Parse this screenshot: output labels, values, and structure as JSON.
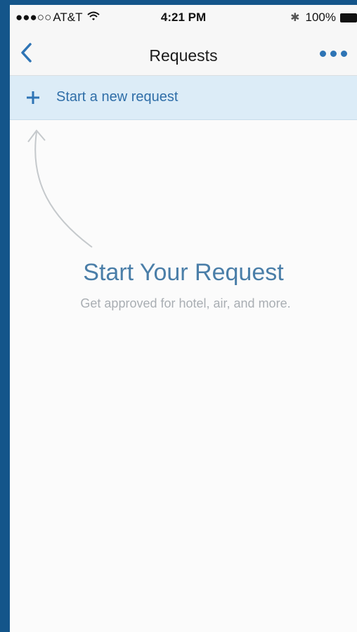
{
  "status_bar": {
    "signal": "●●●○○",
    "carrier": "AT&T",
    "time": "4:21 PM",
    "bluetooth": "✱",
    "battery": "100%"
  },
  "nav": {
    "title": "Requests",
    "back_icon": "chevron-left-icon",
    "more_icon": "ellipsis-icon"
  },
  "new_request": {
    "label": "Start a new request",
    "icon": "plus-icon"
  },
  "empty_state": {
    "title": "Start Your Request",
    "subtitle": "Get approved for hotel, air, and more."
  },
  "colors": {
    "accent": "#2e74b5",
    "banner_bg": "#dcecf7",
    "frame": "#14558a",
    "title_text": "#4a7ea8",
    "subtitle_text": "#a9aeb3"
  }
}
